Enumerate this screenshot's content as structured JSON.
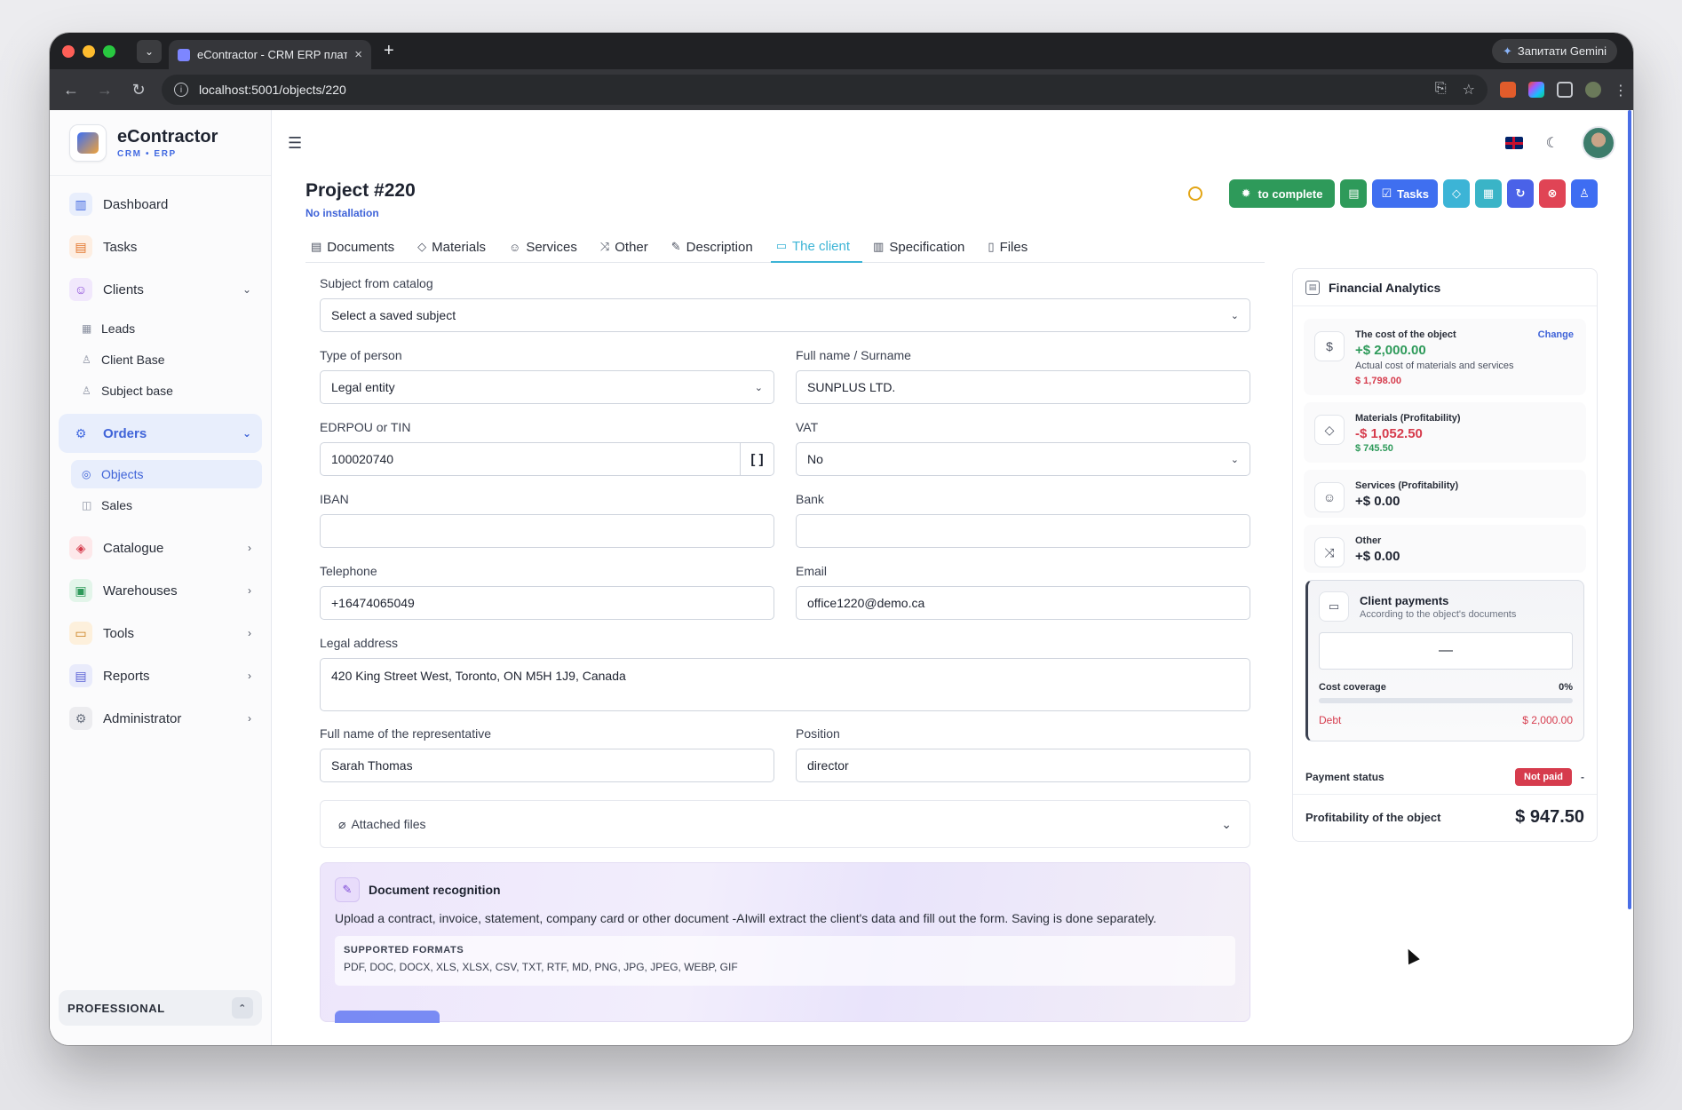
{
  "browser": {
    "tab_title": "eContractor - CRM ERP плат",
    "tab_close": "×",
    "new_tab": "+",
    "gemini": "Запитати Gemini",
    "url": "localhost:5001/objects/220"
  },
  "brand": {
    "name": "eContractor",
    "sub": "CRM • ERP"
  },
  "sidebar": {
    "items": [
      {
        "label": "Dashboard"
      },
      {
        "label": "Tasks"
      },
      {
        "label": "Clients"
      },
      {
        "label": "Orders"
      },
      {
        "label": "Catalogue"
      },
      {
        "label": "Warehouses"
      },
      {
        "label": "Tools"
      },
      {
        "label": "Reports"
      },
      {
        "label": "Administrator"
      }
    ],
    "clients_sub": [
      {
        "label": "Leads"
      },
      {
        "label": "Client Base"
      },
      {
        "label": "Subject base"
      }
    ],
    "orders_sub": [
      {
        "label": "Objects"
      },
      {
        "label": "Sales"
      }
    ],
    "plan": "PROFESSIONAL"
  },
  "project": {
    "title": "Project #220",
    "subtitle": "No installation"
  },
  "actions": {
    "complete": "to complete",
    "tasks": "Tasks"
  },
  "tabs": [
    {
      "label": "Documents"
    },
    {
      "label": "Materials"
    },
    {
      "label": "Services"
    },
    {
      "label": "Other"
    },
    {
      "label": "Description"
    },
    {
      "label": "The client"
    },
    {
      "label": "Specification"
    },
    {
      "label": "Files"
    }
  ],
  "form": {
    "subject_label": "Subject from catalog",
    "subject_value": "Select a saved subject",
    "type_label": "Type of person",
    "type_value": "Legal entity",
    "fullname_label": "Full name / Surname",
    "fullname_value": "SUNPLUS LTD.",
    "edrpou_label": "EDRPOU or TIN",
    "edrpou_value": "100020740",
    "vat_label": "VAT",
    "vat_value": "No",
    "iban_label": "IBAN",
    "iban_value": "",
    "bank_label": "Bank",
    "bank_value": "",
    "phone_label": "Telephone",
    "phone_value": "+16474065049",
    "email_label": "Email",
    "email_value": "office1220@demo.ca",
    "address_label": "Legal address",
    "address_value": "420 King Street West, Toronto, ON M5H 1J9, Canada",
    "rep_label": "Full name of the representative",
    "rep_value": "Sarah Thomas",
    "position_label": "Position",
    "position_value": "director",
    "attached": "Attached files"
  },
  "recognition": {
    "title": "Document recognition",
    "text": "Upload a contract, invoice, statement, company card or other document -AIwill extract the client's data and fill out the form. Saving is done separately.",
    "formats_title": "SUPPORTED FORMATS",
    "formats": "PDF, DOC, DOCX, XLS, XLSX, CSV, TXT, RTF, MD, PNG, JPG, JPEG, WEBP, GIF"
  },
  "finance": {
    "title": "Financial Analytics",
    "cost_title": "The cost of the object",
    "cost_change": "Change",
    "cost_value": "+$ 2,000.00",
    "cost_note": "Actual cost of materials and services",
    "cost_actual": "$ 1,798.00",
    "materials_title": "Materials (Profitability)",
    "materials_value": "-$ 1,052.50",
    "materials_sub": "$ 745.50",
    "services_title": "Services (Profitability)",
    "services_value": "+$ 0.00",
    "other_title": "Other",
    "other_value": "+$ 0.00",
    "payments_title": "Client payments",
    "payments_sub": "According to the object's documents",
    "payments_value": "—",
    "coverage_label": "Cost coverage",
    "coverage_value": "0%",
    "coverage_fraction": 0,
    "debt_label": "Debt",
    "debt_value": "$ 2,000.00",
    "status_label": "Payment status",
    "status_value": "Not paid",
    "status_dash": "-",
    "profit_label": "Profitability of the object",
    "profit_value": "$ 947.50"
  }
}
